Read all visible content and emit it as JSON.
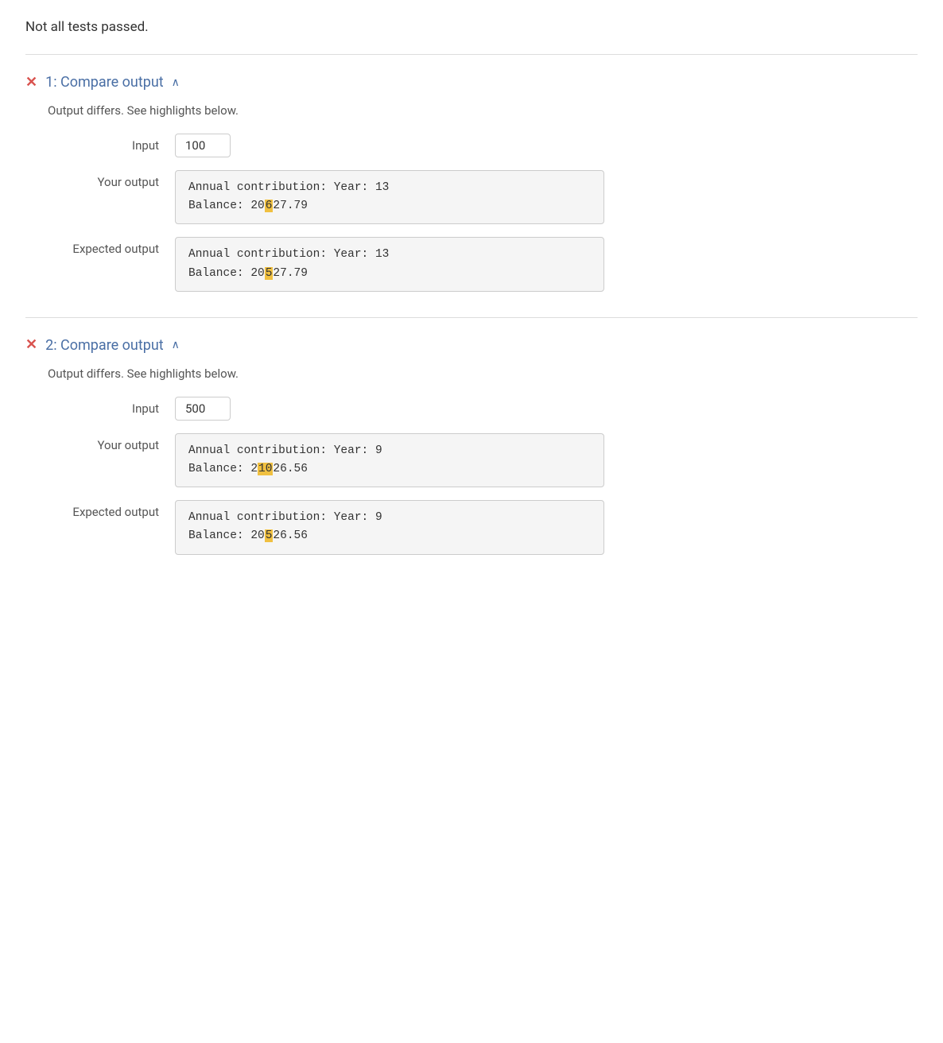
{
  "page": {
    "header": "Not all tests passed.",
    "tests": [
      {
        "id": 1,
        "title": "1: Compare output",
        "status": "fail",
        "message": "Output differs. See highlights below.",
        "input": "100",
        "your_output": {
          "line1": "Annual contribution: Year: 13",
          "line2_prefix": "Balance: 20",
          "line2_highlight": "6",
          "line2_suffix": "27.79"
        },
        "expected_output": {
          "line1": "Annual contribution: Year: 13",
          "line2_prefix": "Balance: 20",
          "line2_highlight": "5",
          "line2_suffix": "27.79"
        }
      },
      {
        "id": 2,
        "title": "2: Compare output",
        "status": "fail",
        "message": "Output differs. See highlights below.",
        "input": "500",
        "your_output": {
          "line1": "Annual contribution: Year: 9",
          "line2_prefix": "Balance: 2",
          "line2_highlight": "10",
          "line2_suffix": "26.56"
        },
        "expected_output": {
          "line1": "Annual contribution: Year: 9",
          "line2_prefix": "Balance: 20",
          "line2_highlight": "5",
          "line2_suffix": "26.56"
        }
      }
    ],
    "labels": {
      "input": "Input",
      "your_output": "Your output",
      "expected_output": "Expected output",
      "caret": "^",
      "x_mark": "✕"
    }
  }
}
